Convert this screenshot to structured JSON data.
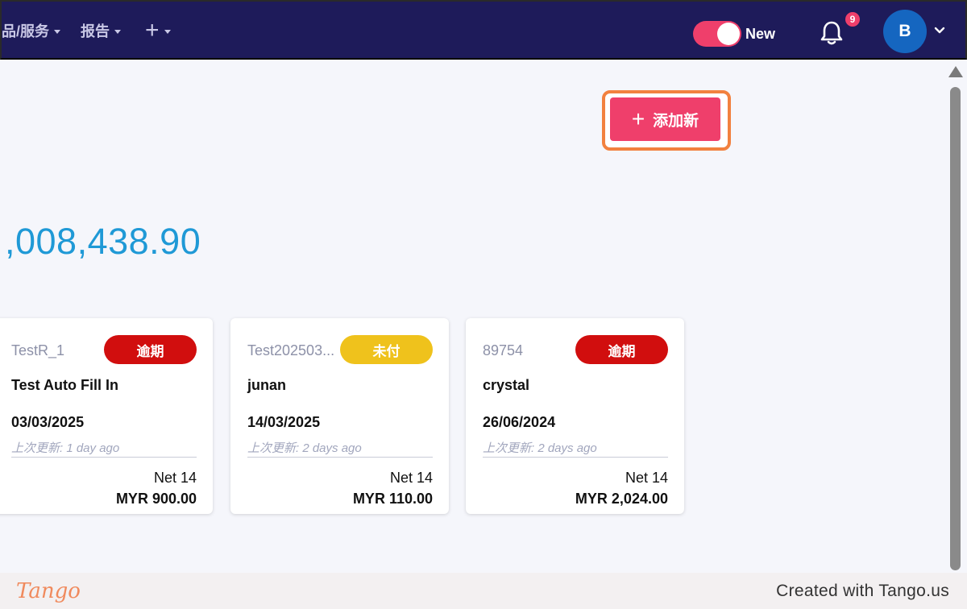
{
  "nav": {
    "items": [
      {
        "label": "品/服务"
      },
      {
        "label": "报告"
      },
      {
        "label": "+"
      }
    ],
    "toggle_label": "New",
    "notification_count": "9",
    "avatar_initial": "B"
  },
  "toolbar": {
    "add_new_label": "添加新"
  },
  "summary": {
    "total": ",008,438.90"
  },
  "invoices": [
    {
      "id": "TestR_1",
      "status": "逾期",
      "status_type": "overdue",
      "customer": "Test Auto Fill In",
      "date": "03/03/2025",
      "updated": "上次更新: 1 day ago",
      "terms": "Net 14",
      "amount": "MYR 900.00"
    },
    {
      "id": "Test202503...",
      "status": "未付",
      "status_type": "unpaid",
      "customer": "junan",
      "date": "14/03/2025",
      "updated": "上次更新: 2 days ago",
      "terms": "Net 14",
      "amount": "MYR 110.00"
    },
    {
      "id": "89754",
      "status": "逾期",
      "status_type": "overdue",
      "customer": "crystal",
      "date": "26/06/2024",
      "updated": "上次更新: 2 days ago",
      "terms": "Net 14",
      "amount": "MYR 2,024.00"
    }
  ],
  "footer": {
    "logo": "Tango",
    "credit": "Created with Tango.us"
  },
  "colors": {
    "nav_bg": "#1e1b5a",
    "accent": "#ef3f6b",
    "highlight_frame": "#f2813f",
    "overdue": "#d10e0e",
    "unpaid": "#efc21c",
    "total_text": "#1f99d6"
  }
}
